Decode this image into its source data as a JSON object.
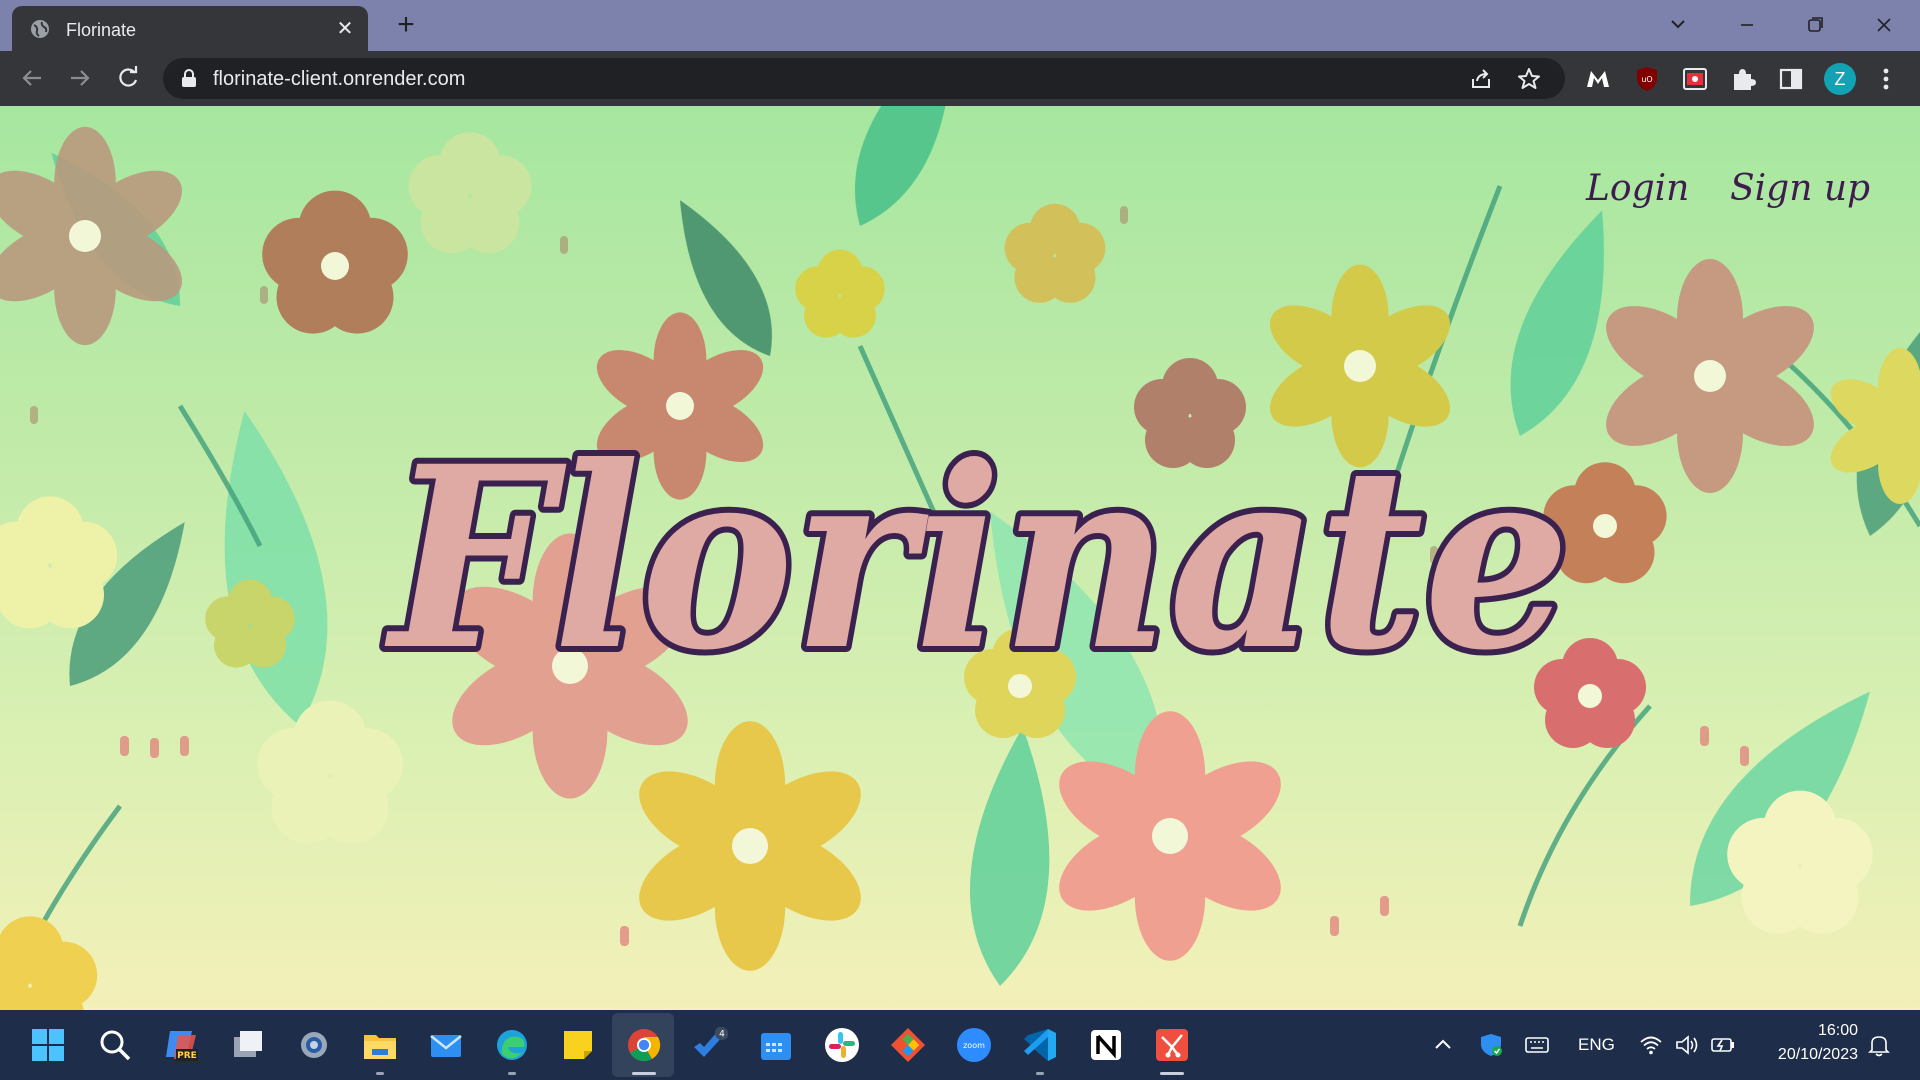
{
  "browser": {
    "tab_title": "Florinate",
    "tab_close": "✕",
    "new_tab": "+",
    "url": "florinate-client.onrender.com",
    "profile_initial": "Z"
  },
  "page": {
    "nav": {
      "login": "Login",
      "signup": "Sign up"
    },
    "hero_title": "Florinate",
    "colors": {
      "title_fill": "#dfaaa4",
      "title_stroke": "#3b2150",
      "nav_text": "#3e1c4e"
    }
  },
  "taskbar": {
    "apps": [
      "start-icon",
      "search-icon",
      "copilot-pre-icon",
      "task-view-icon",
      "settings-icon",
      "file-explorer-icon",
      "mail-icon",
      "edge-icon",
      "sticky-notes-icon",
      "chrome-icon",
      "todo-icon",
      "calendar-icon",
      "slack-icon",
      "git-icon",
      "zoom-icon",
      "vscode-icon",
      "notion-icon",
      "snipping-tool-icon"
    ],
    "todo_badge": "4",
    "zoom_label": "zoom",
    "copilot_label": "PRE",
    "language": "ENG",
    "time": "16:00",
    "date": "20/10/2023"
  }
}
